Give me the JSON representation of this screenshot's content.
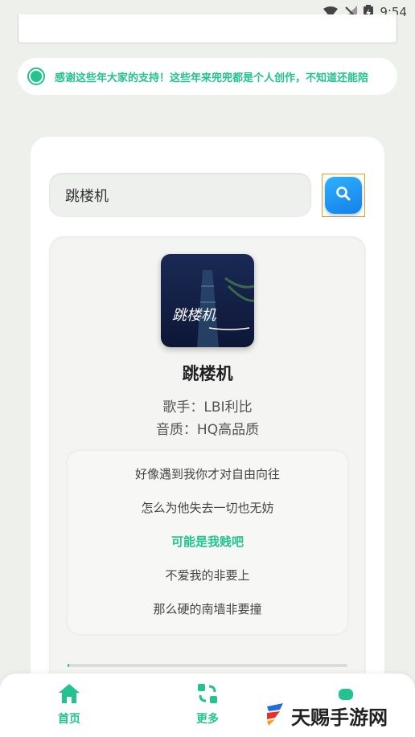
{
  "status_bar": {
    "time": "9:54"
  },
  "notice": {
    "text": "感谢这些年大家的支持！这些年来兜兜都是个人创作，不知道还能陪"
  },
  "search": {
    "value": "跳楼机"
  },
  "song": {
    "album_art_text": "跳楼机",
    "title": "跳楼机",
    "singer": "歌手：LBI利比",
    "quality": "音质：HQ高品质"
  },
  "lyrics": [
    {
      "text": "好像遇到我你才对自由向往",
      "active": false
    },
    {
      "text": "怎么为他失去一切也无妨",
      "active": false
    },
    {
      "text": "可能是我贱吧",
      "active": true
    },
    {
      "text": "不爱我的非要上",
      "active": false
    },
    {
      "text": "那么硬的南墙非要撞",
      "active": false
    }
  ],
  "progress": {
    "fraction": 0.005
  },
  "bottom_nav": {
    "items": [
      {
        "label": "首页",
        "icon": "home-icon"
      },
      {
        "label": "更多",
        "icon": "swap-icon"
      },
      {
        "label": "",
        "icon": "database-icon"
      }
    ]
  },
  "watermark": {
    "text": "天赐手游网"
  },
  "colors": {
    "accent": "#22c38e",
    "search_button": "#1a8ff0",
    "background": "#eef0ec"
  }
}
